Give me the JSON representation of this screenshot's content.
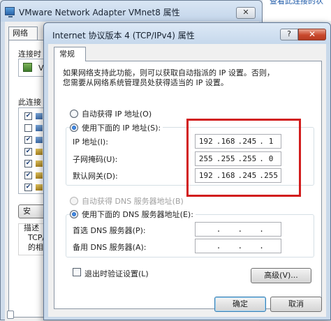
{
  "background_window": {
    "title": "VMware Network Adapter VMnet8 属性",
    "close_glyph": "✕",
    "tab_label": "网络",
    "connect_label": "连接时",
    "device_text": "V",
    "components_label": "此连接",
    "install_label": "安",
    "desc_label": "描述",
    "desc_line1": "TCP/",
    "desc_line2": "的相",
    "help_text": "查看此连接的状"
  },
  "dialog": {
    "title": "Internet 协议版本 4 (TCP/IPv4) 属性",
    "help_glyph": "?",
    "close_glyph": "✕",
    "tab_label": "常规",
    "description_line1": "如果网络支持此功能，则可以获取自动指派的 IP 设置。否则，",
    "description_line2": "您需要从网络系统管理员处获得适当的 IP 设置。",
    "ip_auto_label": "自动获得 IP 地址(O)",
    "ip_manual_label": "使用下面的 IP 地址(S):",
    "ip_address_label": "IP 地址(I):",
    "ip_address": [
      "192",
      "168",
      "245",
      "1"
    ],
    "subnet_label": "子网掩码(U):",
    "subnet_mask": [
      "255",
      "255",
      "255",
      "0"
    ],
    "gateway_label": "默认网关(D):",
    "gateway": [
      "192",
      "168",
      "245",
      "255"
    ],
    "dns_auto_label": "自动获得 DNS 服务器地址(B)",
    "dns_manual_label": "使用下面的 DNS 服务器地址(E):",
    "preferred_dns_label": "首选 DNS 服务器(P):",
    "alternate_dns_label": "备用 DNS 服务器(A):",
    "validate_label": "退出时验证设置(L)",
    "advanced_label": "高级(V)...",
    "ok_label": "确定",
    "cancel_label": "取消",
    "ip_mode": "manual",
    "dns_mode": "manual",
    "validate_checked": false
  },
  "colors": {
    "highlight_frame": "#d21d1d",
    "close_button": "#c9482d"
  }
}
